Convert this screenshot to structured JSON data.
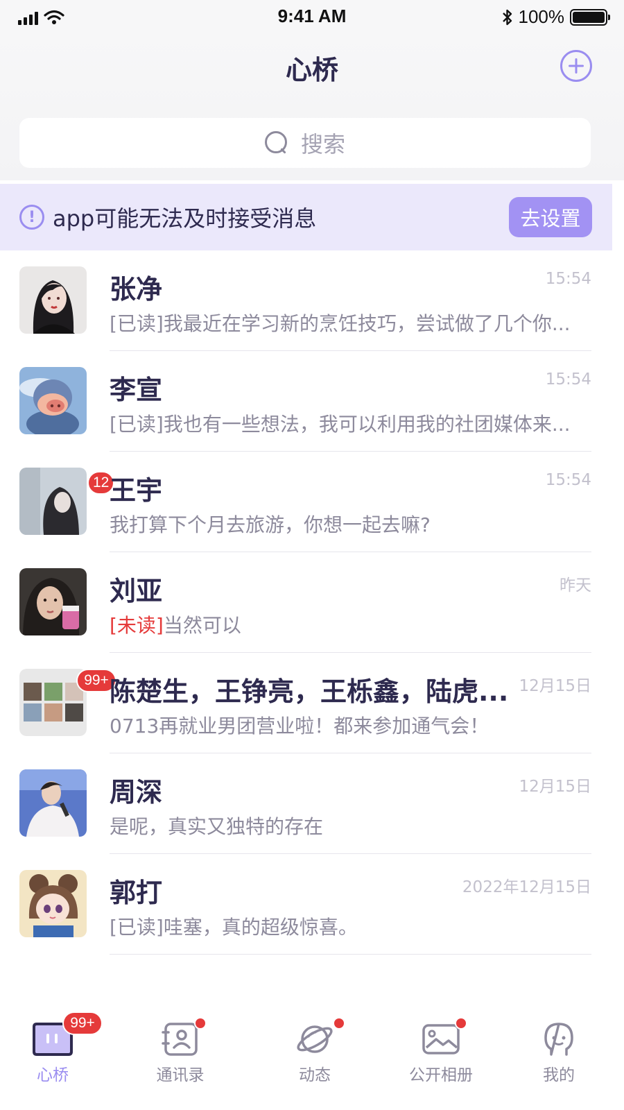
{
  "status_bar": {
    "time": "9:41 AM",
    "battery_percent": "100%",
    "battery_level": 1.0,
    "signal_icon": "cellular-signal-icon",
    "wifi_icon": "wifi-icon",
    "bluetooth_icon": "bluetooth-icon"
  },
  "header": {
    "title": "心桥",
    "add_icon": "plus-circle-icon"
  },
  "search": {
    "placeholder": "搜索",
    "icon": "search-icon"
  },
  "notice": {
    "text": "app可能无法及时接受消息",
    "button_label": "去设置",
    "icon": "exclamation-circle-icon"
  },
  "chats": [
    {
      "name": "张净",
      "time": "15:54",
      "status_tag": "[已读]",
      "preview": "我最近在学习新的烹饪技巧，尝试做了几个你...",
      "badge": ""
    },
    {
      "name": "李宣",
      "time": "15:54",
      "status_tag": "[已读]",
      "preview": "我也有一些想法，我可以利用我的社团媒体来...",
      "badge": ""
    },
    {
      "name": "王宇",
      "time": "15:54",
      "status_tag": "",
      "preview": "我打算下个月去旅游，你想一起去嘛?",
      "badge": "12"
    },
    {
      "name": "刘亚",
      "time": "昨天",
      "status_tag": "[未读]",
      "preview": "当然可以",
      "badge": ""
    },
    {
      "name": "陈楚生，王铮亮，王栎鑫，陆虎...",
      "time": "12月15日",
      "status_tag": "",
      "preview": "0713再就业男团营业啦！都来参加通气会！",
      "badge": "99+"
    },
    {
      "name": "周深",
      "time": "12月15日",
      "status_tag": "",
      "preview": "是呢，真实又独特的存在",
      "badge": ""
    },
    {
      "name": "郭打",
      "time": "2022年12月15日",
      "status_tag": "[已读]",
      "preview": "哇塞，真的超级惊喜。",
      "badge": ""
    }
  ],
  "tabs": [
    {
      "label": "心桥",
      "icon": "chat-bubble-icon",
      "badge": "99+",
      "active": true
    },
    {
      "label": "通讯录",
      "icon": "contacts-icon",
      "dot": true
    },
    {
      "label": "动态",
      "icon": "planet-icon",
      "dot": true
    },
    {
      "label": "公开相册",
      "icon": "photo-album-icon",
      "dot": true
    },
    {
      "label": "我的",
      "icon": "profile-icon",
      "dot": false
    }
  ],
  "colors": {
    "accent": "#9a8df0",
    "accent_button": "#a292f3",
    "notice_bg": "#ebe8fb",
    "badge_red": "#e53a3a",
    "text_primary": "#2e2a4f",
    "text_secondary": "#8d8a9c"
  }
}
